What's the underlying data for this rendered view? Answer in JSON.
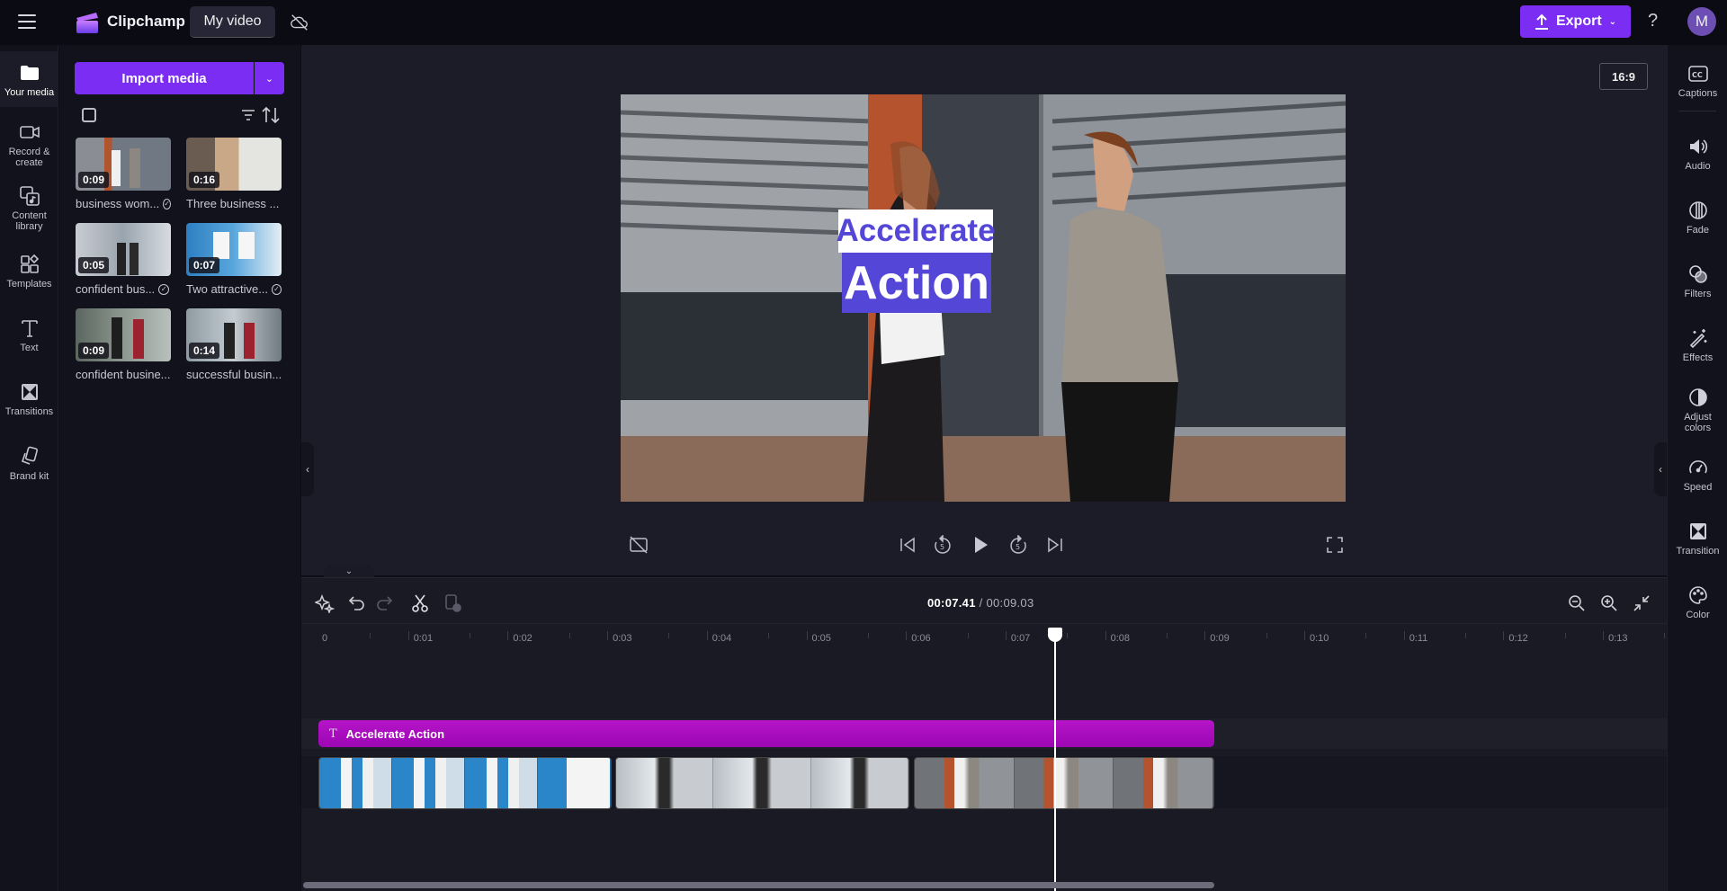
{
  "app": {
    "brand": "Clipchamp",
    "project_name": "My video",
    "export_label": "Export",
    "help_label": "?",
    "avatar_initial": "M",
    "accent_color": "#7c2df3"
  },
  "left_nav": {
    "items": [
      {
        "label": "Your media",
        "icon": "folder-icon",
        "active": true
      },
      {
        "label": "Record & create",
        "icon": "camera-icon"
      },
      {
        "label": "Content library",
        "icon": "content-library-icon"
      },
      {
        "label": "Templates",
        "icon": "templates-icon"
      },
      {
        "label": "Text",
        "icon": "text-icon"
      },
      {
        "label": "Transitions",
        "icon": "transitions-icon"
      },
      {
        "label": "Brand kit",
        "icon": "brand-kit-icon"
      }
    ]
  },
  "media_panel": {
    "import_label": "Import media",
    "items": [
      {
        "name": "business wom...",
        "duration": "0:09",
        "used": true
      },
      {
        "name": "Three business ...",
        "duration": "0:16",
        "used": false
      },
      {
        "name": "confident bus...",
        "duration": "0:05",
        "used": true
      },
      {
        "name": "Two attractive...",
        "duration": "0:07",
        "used": true
      },
      {
        "name": "confident busine...",
        "duration": "0:09",
        "used": false
      },
      {
        "name": "successful busin...",
        "duration": "0:14",
        "used": false
      }
    ]
  },
  "preview": {
    "aspect_ratio": "16:9",
    "overlay_line1": "Accelerate",
    "overlay_line2": "Action",
    "overlay_color": "#5446d6"
  },
  "timeline": {
    "current_time": "00:07.41",
    "separator": " / ",
    "total_time": "00:09.03",
    "ruler_labels": [
      "0",
      "0:01",
      "0:02",
      "0:03",
      "0:04",
      "0:05",
      "0:06",
      "0:07",
      "0:08",
      "0:09",
      "0:10",
      "0:11",
      "0:12",
      "0:13"
    ],
    "text_clip_label": "Accelerate Action",
    "text_clip_color": "#a80cbd",
    "playhead_seconds": 7.41
  },
  "right_nav": {
    "items": [
      {
        "label": "Captions",
        "icon": "captions-icon"
      },
      {
        "label": "Audio",
        "icon": "audio-icon"
      },
      {
        "label": "Fade",
        "icon": "fade-icon"
      },
      {
        "label": "Filters",
        "icon": "filters-icon"
      },
      {
        "label": "Effects",
        "icon": "effects-icon"
      },
      {
        "label": "Adjust colors",
        "icon": "adjust-colors-icon"
      },
      {
        "label": "Speed",
        "icon": "speed-icon"
      },
      {
        "label": "Transition",
        "icon": "transition-icon"
      },
      {
        "label": "Color",
        "icon": "color-palette-icon"
      }
    ]
  }
}
